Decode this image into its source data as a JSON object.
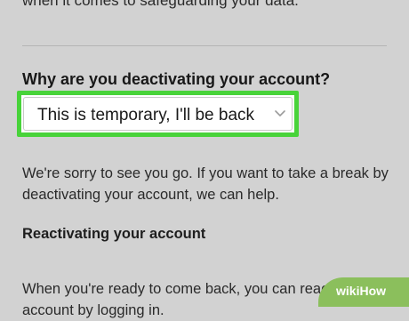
{
  "content": {
    "top_text": "when it comes to safeguarding your data.",
    "question": "Why are you deactivating your account?",
    "reason_select": {
      "value": "This is temporary, I'll be back"
    },
    "sorry_text": "We're sorry to see you go. If you want to take a break by deactivating your account, we can help.",
    "reactivating_heading": "Reactivating your account",
    "bottom_text": "When you're ready to come back, you can reactivate your account by logging in."
  },
  "watermark": "wikiHow",
  "colors": {
    "highlight": "#48d33a",
    "background": "#d2d2d2"
  }
}
